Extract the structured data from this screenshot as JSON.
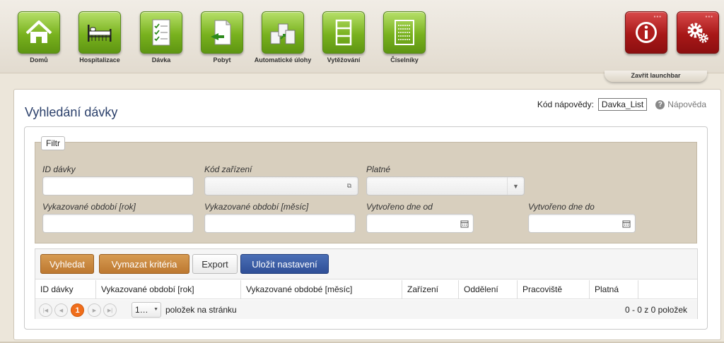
{
  "launchbar": {
    "items": [
      {
        "label": "Domů",
        "icon": "home-icon"
      },
      {
        "label": "Hospitalizace",
        "icon": "hospital-bed-icon"
      },
      {
        "label": "Dávka",
        "icon": "checklist-icon"
      },
      {
        "label": "Pobyt",
        "icon": "document-arrow-icon"
      },
      {
        "label": "Automatické úlohy",
        "icon": "boxes-icon"
      },
      {
        "label": "Vytěžování",
        "icon": "rack-icon"
      },
      {
        "label": "Číselníky",
        "icon": "codebook-icon"
      }
    ],
    "info_icon": "info-icon",
    "settings_icon": "gear-icon",
    "close_label": "Zavřít launchbar"
  },
  "page": {
    "title": "Vyhledání dávky",
    "help_code_label": "Kód nápovědy:",
    "help_code_value": "Davka_List",
    "help_link": "Nápověda"
  },
  "filter": {
    "legend": "Filtr",
    "fields": {
      "id_davky": {
        "label": "ID dávky",
        "value": ""
      },
      "kod_zarizeni": {
        "label": "Kód zařízení",
        "value": ""
      },
      "platne": {
        "label": "Platné",
        "value": ""
      },
      "obdobi_rok": {
        "label": "Vykazované období [rok]",
        "value": ""
      },
      "obdobi_mesic": {
        "label": "Vykazované období [měsíc]",
        "value": ""
      },
      "vytvoreno_od": {
        "label": "Vytvořeno dne od",
        "value": ""
      },
      "vytvoreno_do": {
        "label": "Vytvořeno dne do",
        "value": ""
      }
    }
  },
  "toolbar": {
    "search": "Vyhledat",
    "clear": "Vymazat kritéria",
    "export": "Export",
    "save": "Uložit nastavení"
  },
  "grid": {
    "columns": [
      "ID dávky",
      "Vykazované období [rok]",
      "Vykazované obdobé [měsíc]",
      "Zařízení",
      "Oddělení",
      "Pracoviště",
      "Platná"
    ],
    "rows": []
  },
  "pager": {
    "current_page": "1",
    "page_size": "1…",
    "page_size_label": "položek na stránku",
    "info": "0 - 0 z 0 položek"
  },
  "colors": {
    "launch_green": "#79b21e",
    "launch_red": "#a81818",
    "orange_button": "#c98a3f",
    "blue_button": "#3a5ba5",
    "filter_bg": "#d8cfbe",
    "title": "#2a3f6a",
    "pager_active": "#f06d1a"
  }
}
